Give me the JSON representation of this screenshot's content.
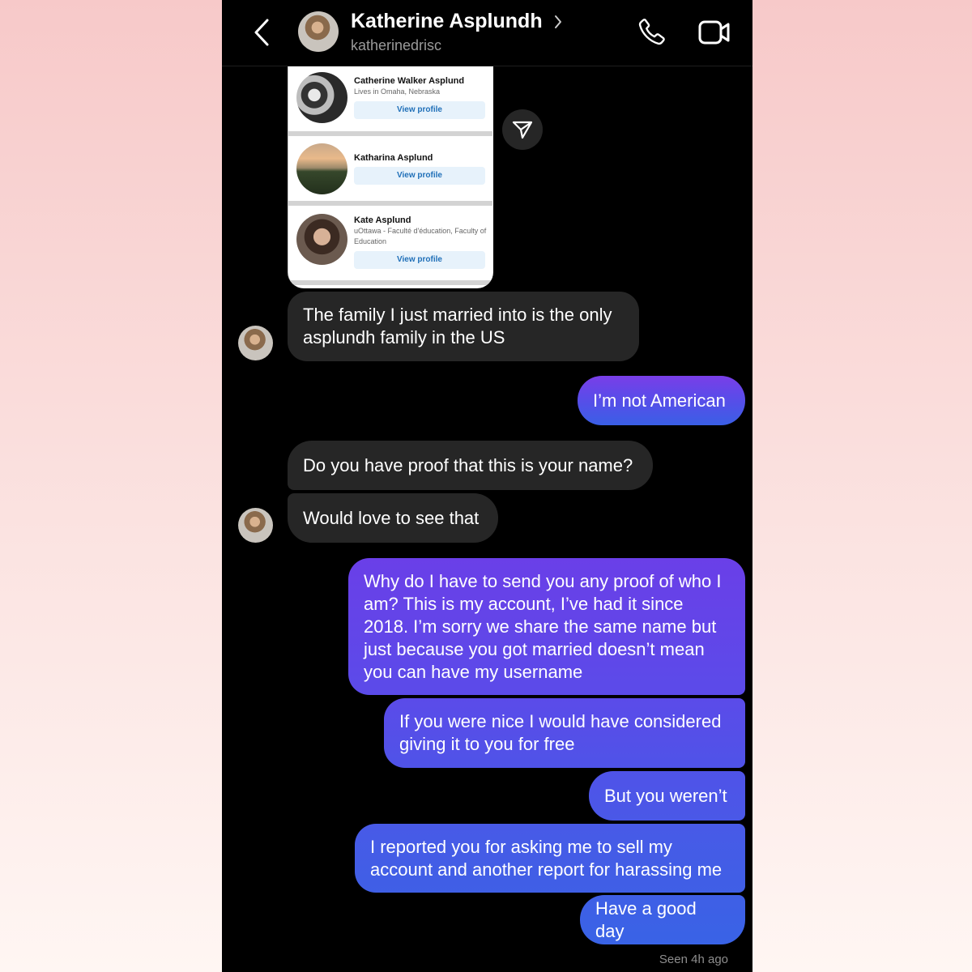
{
  "header": {
    "name": "Katherine Asplundh",
    "username": "katherinedrisc"
  },
  "shared_card": {
    "items": [
      {
        "name": "Catherine Walker Asplund",
        "subtitle": "Lives in Omaha, Nebraska",
        "button": "View profile"
      },
      {
        "name": "Katharina Asplund",
        "subtitle": "",
        "button": "View profile"
      },
      {
        "name": "Kate Asplund",
        "subtitle": "uOttawa - Faculté d'éducation, Faculty of Education",
        "button": "View profile"
      }
    ]
  },
  "messages": [
    {
      "sender": "them",
      "text": "The family I just married into is the only\nasplundh family in the US"
    },
    {
      "sender": "me",
      "text": "I’m not American"
    },
    {
      "sender": "them",
      "text": "Do you have proof that this is your name?"
    },
    {
      "sender": "them",
      "text": "Would love to see that"
    },
    {
      "sender": "me",
      "text": "Why do I have to send you any proof of who I\nam? This is my account, I’ve had it since\n2018. I’m sorry we share the same name but\njust because you got married doesn’t mean\nyou can have my username"
    },
    {
      "sender": "me",
      "text": "If you were nice I would have considered\ngiving it to you for free"
    },
    {
      "sender": "me",
      "text": "But you weren’t"
    },
    {
      "sender": "me",
      "text": "I reported you for asking me to sell my\naccount and another report for harassing me"
    },
    {
      "sender": "me",
      "text": "Have a good day"
    }
  ],
  "status": {
    "seen": "Seen 4h ago"
  },
  "colors": {
    "incoming_bubble": "#262626",
    "outgoing_top": "#7a3ee8",
    "outgoing_bottom": "#3a5fe6",
    "background": "#000000"
  },
  "icons": [
    "back-arrow-icon",
    "chevron-right-icon",
    "phone-icon",
    "video-camera-icon",
    "send-icon"
  ]
}
